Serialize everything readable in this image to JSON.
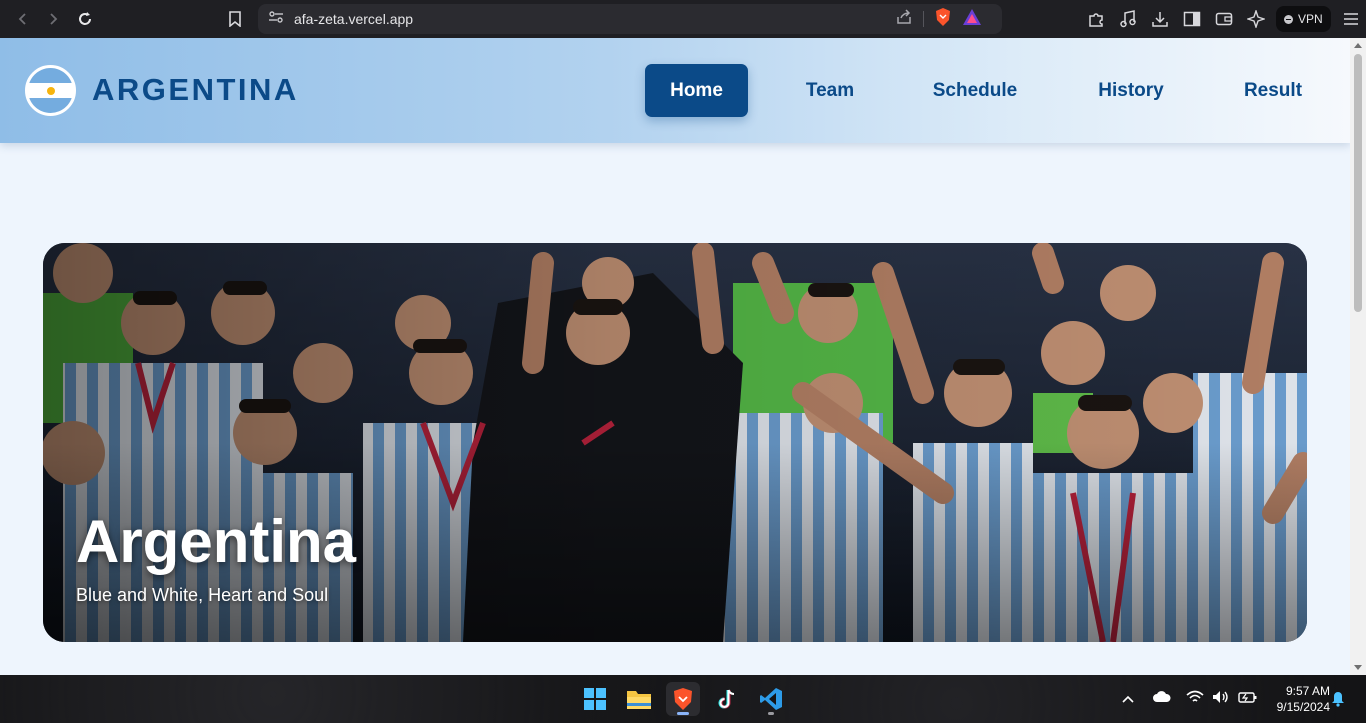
{
  "browser": {
    "url": "afa-zeta.vercel.app",
    "vpn_label": "VPN"
  },
  "site": {
    "brand": "ARGENTINA",
    "menu": [
      {
        "label": "Home",
        "active": true
      },
      {
        "label": "Team",
        "active": false
      },
      {
        "label": "Schedule",
        "active": false
      },
      {
        "label": "History",
        "active": false
      },
      {
        "label": "Result",
        "active": false
      }
    ]
  },
  "hero": {
    "title": "Argentina",
    "subtitle": "Blue and White, Heart and Soul"
  },
  "taskbar": {
    "apps": [
      "windows-start",
      "file-explorer",
      "brave-browser",
      "tiktok",
      "vscode"
    ],
    "time": "9:57 AM",
    "date": "9/15/2024"
  },
  "colors": {
    "brand_blue": "#0b4a88",
    "sky_blue": "#74acdf",
    "page_bg": "#eef5fd"
  }
}
